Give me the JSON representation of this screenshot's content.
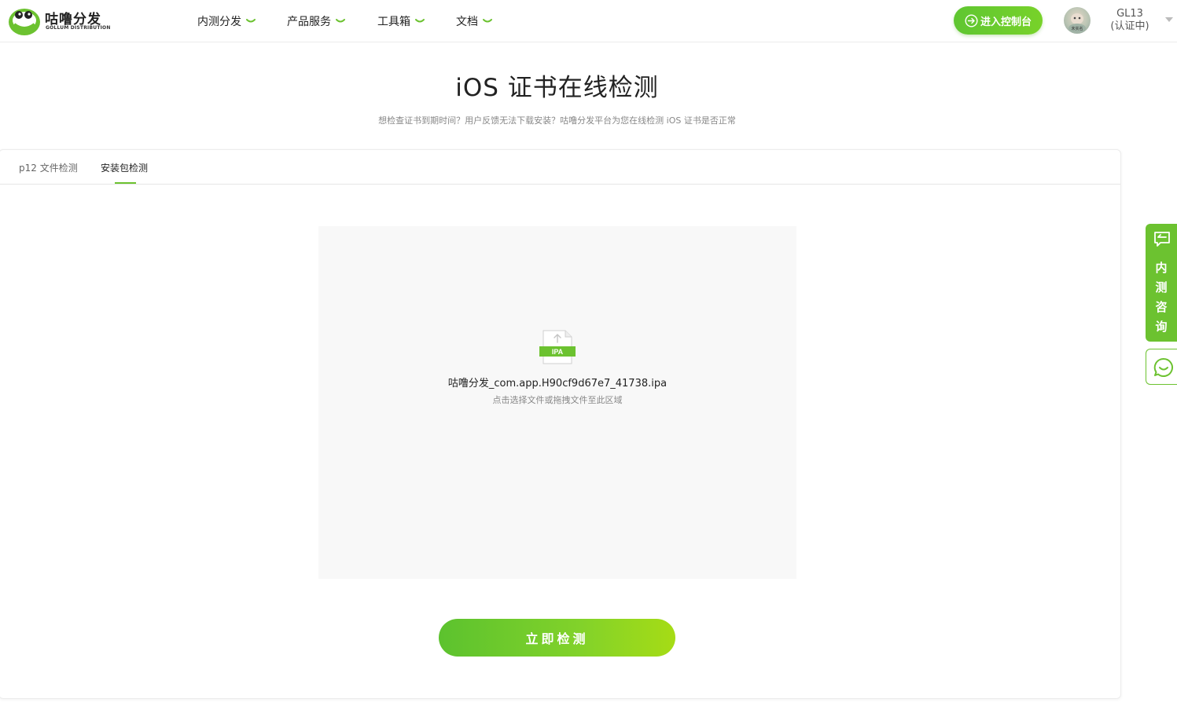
{
  "brand": {
    "name": "咕噜分发",
    "subtitle": "GOLLUM DISTRIBUTION",
    "accent_color": "#6cc230"
  },
  "nav": {
    "items": [
      {
        "label": "内测分发"
      },
      {
        "label": "产品服务"
      },
      {
        "label": "工具箱"
      },
      {
        "label": "文档"
      }
    ]
  },
  "header": {
    "console_button": "进入控制台",
    "avatar_caption": "未实名",
    "user_name": "GL13",
    "user_status": "(认证中)"
  },
  "page": {
    "title": "iOS 证书在线检测",
    "subtitle": "想检查证书到期时间？用户反馈无法下载安装？咕噜分发平台为您在线检测 iOS 证书是否正常"
  },
  "tabs": [
    {
      "label": "p12 文件检测",
      "active": false
    },
    {
      "label": "安装包检测",
      "active": true
    }
  ],
  "upload": {
    "file_type": "IPA",
    "file_name": "咕噜分发_com.app.H90cf9d67e7_41738.ipa",
    "hint": "点击选择文件或拖拽文件至此区域"
  },
  "check_button": "立即检测",
  "float": {
    "consult_chars": [
      "内",
      "测",
      "咨",
      "询"
    ]
  }
}
